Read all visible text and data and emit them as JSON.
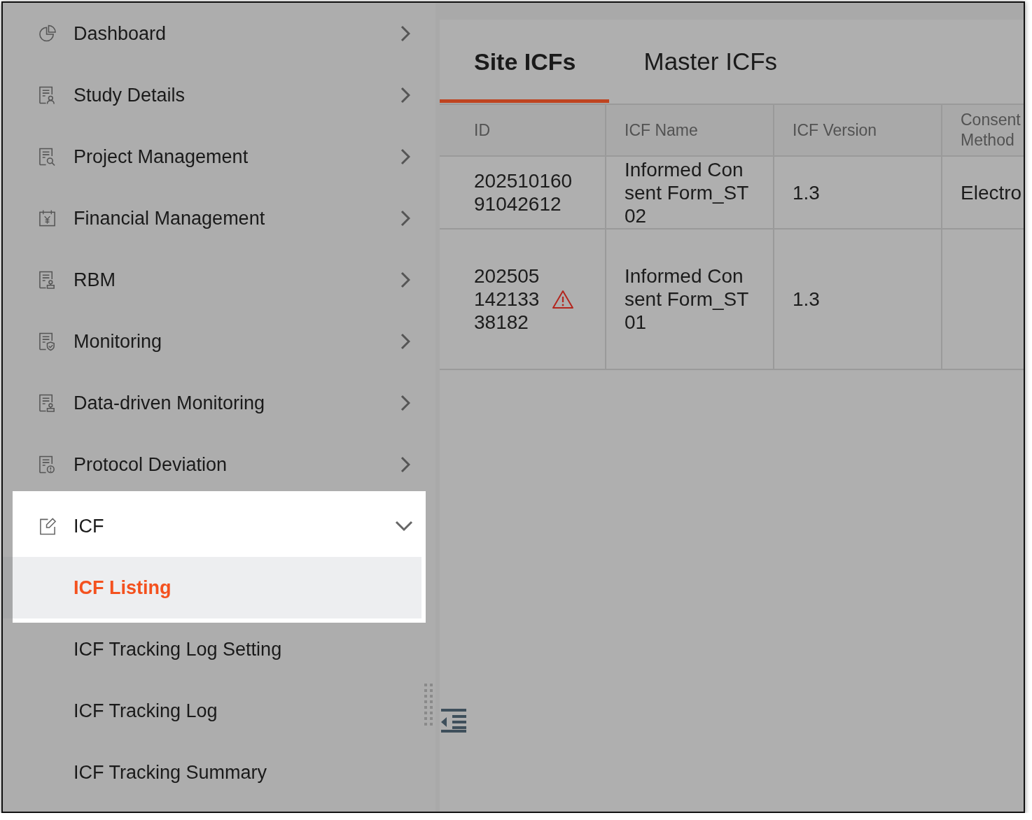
{
  "sidebar": {
    "items": [
      {
        "label": "Dashboard",
        "expanded": false,
        "spotlight": false
      },
      {
        "label": "Study Details",
        "expanded": false,
        "spotlight": false
      },
      {
        "label": "Project Management",
        "expanded": false,
        "spotlight": false
      },
      {
        "label": "Financial Management",
        "expanded": false,
        "spotlight": false
      },
      {
        "label": "RBM",
        "expanded": false,
        "spotlight": false
      },
      {
        "label": "Monitoring",
        "expanded": false,
        "spotlight": false
      },
      {
        "label": "Data-driven Monitoring",
        "expanded": false,
        "spotlight": false
      },
      {
        "label": "Protocol Deviation",
        "expanded": false,
        "spotlight": false
      },
      {
        "label": "ICF",
        "expanded": true,
        "spotlight": true,
        "children": [
          {
            "label": "ICF Listing",
            "selected": true
          },
          {
            "label": "ICF Tracking Log Setting",
            "selected": false
          },
          {
            "label": "ICF Tracking Log",
            "selected": false
          },
          {
            "label": "ICF Tracking Summary",
            "selected": false
          }
        ]
      }
    ]
  },
  "tabs": [
    {
      "label": "Site ICFs",
      "selected": true
    },
    {
      "label": "Master ICFs",
      "selected": false
    }
  ],
  "table": {
    "columns": [
      "ID",
      "ICF Name",
      "ICF Version",
      "Consent Method"
    ],
    "rows": [
      {
        "id": "20251016091042612",
        "icf_name": "Informed Consent Form_ST02",
        "icf_version": "1.3",
        "consent_method": "Electro",
        "warning": false
      },
      {
        "id": "20250514213338182",
        "icf_name": "Informed Consent Form_ST01",
        "icf_version": "1.3",
        "warning": true
      }
    ]
  }
}
